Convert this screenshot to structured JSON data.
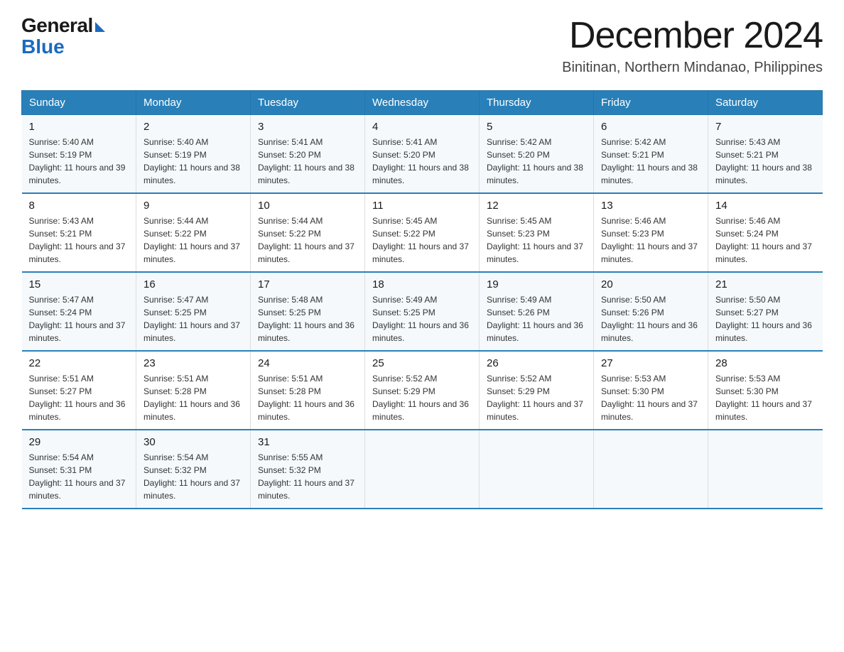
{
  "header": {
    "logo": {
      "general": "General",
      "blue": "Blue"
    },
    "title": "December 2024",
    "location": "Binitinan, Northern Mindanao, Philippines"
  },
  "days_of_week": [
    "Sunday",
    "Monday",
    "Tuesday",
    "Wednesday",
    "Thursday",
    "Friday",
    "Saturday"
  ],
  "weeks": [
    [
      {
        "day": "1",
        "sunrise": "5:40 AM",
        "sunset": "5:19 PM",
        "daylight": "11 hours and 39 minutes."
      },
      {
        "day": "2",
        "sunrise": "5:40 AM",
        "sunset": "5:19 PM",
        "daylight": "11 hours and 38 minutes."
      },
      {
        "day": "3",
        "sunrise": "5:41 AM",
        "sunset": "5:20 PM",
        "daylight": "11 hours and 38 minutes."
      },
      {
        "day": "4",
        "sunrise": "5:41 AM",
        "sunset": "5:20 PM",
        "daylight": "11 hours and 38 minutes."
      },
      {
        "day": "5",
        "sunrise": "5:42 AM",
        "sunset": "5:20 PM",
        "daylight": "11 hours and 38 minutes."
      },
      {
        "day": "6",
        "sunrise": "5:42 AM",
        "sunset": "5:21 PM",
        "daylight": "11 hours and 38 minutes."
      },
      {
        "day": "7",
        "sunrise": "5:43 AM",
        "sunset": "5:21 PM",
        "daylight": "11 hours and 38 minutes."
      }
    ],
    [
      {
        "day": "8",
        "sunrise": "5:43 AM",
        "sunset": "5:21 PM",
        "daylight": "11 hours and 37 minutes."
      },
      {
        "day": "9",
        "sunrise": "5:44 AM",
        "sunset": "5:22 PM",
        "daylight": "11 hours and 37 minutes."
      },
      {
        "day": "10",
        "sunrise": "5:44 AM",
        "sunset": "5:22 PM",
        "daylight": "11 hours and 37 minutes."
      },
      {
        "day": "11",
        "sunrise": "5:45 AM",
        "sunset": "5:22 PM",
        "daylight": "11 hours and 37 minutes."
      },
      {
        "day": "12",
        "sunrise": "5:45 AM",
        "sunset": "5:23 PM",
        "daylight": "11 hours and 37 minutes."
      },
      {
        "day": "13",
        "sunrise": "5:46 AM",
        "sunset": "5:23 PM",
        "daylight": "11 hours and 37 minutes."
      },
      {
        "day": "14",
        "sunrise": "5:46 AM",
        "sunset": "5:24 PM",
        "daylight": "11 hours and 37 minutes."
      }
    ],
    [
      {
        "day": "15",
        "sunrise": "5:47 AM",
        "sunset": "5:24 PM",
        "daylight": "11 hours and 37 minutes."
      },
      {
        "day": "16",
        "sunrise": "5:47 AM",
        "sunset": "5:25 PM",
        "daylight": "11 hours and 37 minutes."
      },
      {
        "day": "17",
        "sunrise": "5:48 AM",
        "sunset": "5:25 PM",
        "daylight": "11 hours and 36 minutes."
      },
      {
        "day": "18",
        "sunrise": "5:49 AM",
        "sunset": "5:25 PM",
        "daylight": "11 hours and 36 minutes."
      },
      {
        "day": "19",
        "sunrise": "5:49 AM",
        "sunset": "5:26 PM",
        "daylight": "11 hours and 36 minutes."
      },
      {
        "day": "20",
        "sunrise": "5:50 AM",
        "sunset": "5:26 PM",
        "daylight": "11 hours and 36 minutes."
      },
      {
        "day": "21",
        "sunrise": "5:50 AM",
        "sunset": "5:27 PM",
        "daylight": "11 hours and 36 minutes."
      }
    ],
    [
      {
        "day": "22",
        "sunrise": "5:51 AM",
        "sunset": "5:27 PM",
        "daylight": "11 hours and 36 minutes."
      },
      {
        "day": "23",
        "sunrise": "5:51 AM",
        "sunset": "5:28 PM",
        "daylight": "11 hours and 36 minutes."
      },
      {
        "day": "24",
        "sunrise": "5:51 AM",
        "sunset": "5:28 PM",
        "daylight": "11 hours and 36 minutes."
      },
      {
        "day": "25",
        "sunrise": "5:52 AM",
        "sunset": "5:29 PM",
        "daylight": "11 hours and 36 minutes."
      },
      {
        "day": "26",
        "sunrise": "5:52 AM",
        "sunset": "5:29 PM",
        "daylight": "11 hours and 37 minutes."
      },
      {
        "day": "27",
        "sunrise": "5:53 AM",
        "sunset": "5:30 PM",
        "daylight": "11 hours and 37 minutes."
      },
      {
        "day": "28",
        "sunrise": "5:53 AM",
        "sunset": "5:30 PM",
        "daylight": "11 hours and 37 minutes."
      }
    ],
    [
      {
        "day": "29",
        "sunrise": "5:54 AM",
        "sunset": "5:31 PM",
        "daylight": "11 hours and 37 minutes."
      },
      {
        "day": "30",
        "sunrise": "5:54 AM",
        "sunset": "5:32 PM",
        "daylight": "11 hours and 37 minutes."
      },
      {
        "day": "31",
        "sunrise": "5:55 AM",
        "sunset": "5:32 PM",
        "daylight": "11 hours and 37 minutes."
      },
      null,
      null,
      null,
      null
    ]
  ],
  "labels": {
    "sunrise": "Sunrise: ",
    "sunset": "Sunset: ",
    "daylight": "Daylight: "
  },
  "colors": {
    "header_bg": "#2980b9",
    "accent": "#1a6bbf"
  }
}
